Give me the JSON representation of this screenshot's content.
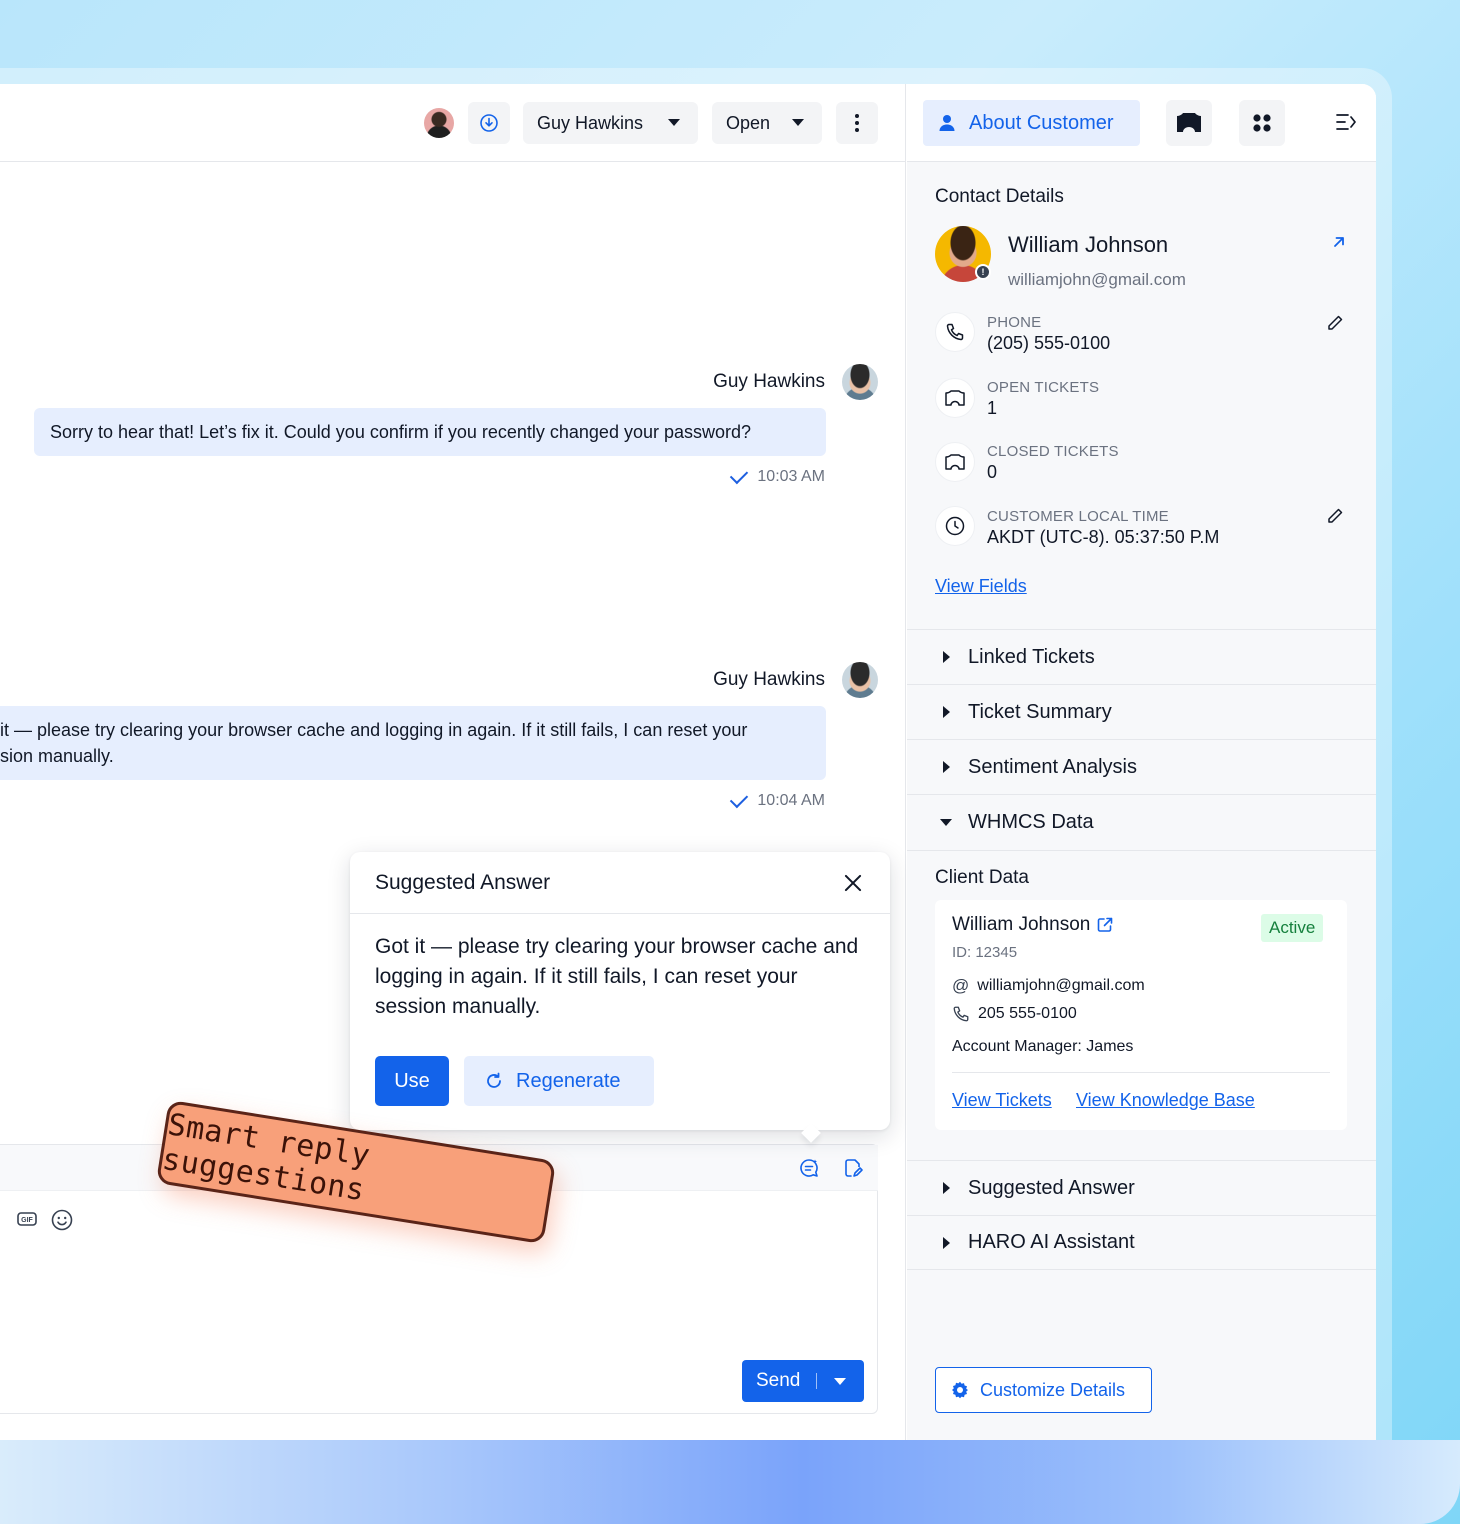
{
  "topbar": {
    "assignee": "Guy Hawkins",
    "status": "Open"
  },
  "messages": [
    {
      "author": "Guy Hawkins",
      "text": "Sorry to hear that! Let’s fix it. Could you confirm if you recently changed your password?",
      "time": "10:03 AM"
    },
    {
      "author": "Guy Hawkins",
      "line1": "it — please try clearing your browser cache and logging in again. If it still fails, I can reset your",
      "line2": "sion manually.",
      "time": "10:04 AM"
    }
  ],
  "suggested_popup": {
    "title": "Suggested Answer",
    "body": "Got it — please try clearing your browser cache and logging in again. If it still fails, I can reset your session manually.",
    "use_label": "Use",
    "regenerate_label": "Regenerate"
  },
  "sticker": "Smart reply suggestions",
  "composer": {
    "send_label": "Send"
  },
  "right_panel": {
    "tab_label": "About Customer",
    "contact_details_title": "Contact Details",
    "contact": {
      "name": "William Johnson",
      "email": "williamjohn@gmail.com"
    },
    "fields": [
      {
        "label": "PHONE",
        "value": "(205) 555-0100"
      },
      {
        "label": "OPEN TICKETS",
        "value": "1"
      },
      {
        "label": "CLOSED TICKETS",
        "value": "0"
      },
      {
        "label": "CUSTOMER LOCAL TIME",
        "value": "AKDT (UTC-8). 05:37:50 P.M"
      }
    ],
    "view_fields": "View Fields",
    "sections": [
      "Linked Tickets",
      "Ticket Summary",
      "Sentiment Analysis",
      "WHMCS Data"
    ],
    "client_data_title": "Client Data",
    "client_card": {
      "name": "William Johnson",
      "id": "ID: 12345",
      "status": "Active",
      "email": "williamjohn@gmail.com",
      "phone": "205 555-0100",
      "account_manager": "Account Manager: James",
      "view_tickets": "View Tickets",
      "view_kb": "View Knowledge Base"
    },
    "lower_sections": [
      "Suggested Answer",
      "HARO AI Assistant"
    ],
    "customize_label": "Customize Details"
  },
  "colors": {
    "accent": "#1363ea",
    "bubble": "#e6eefe",
    "sticker": "#f8a07a",
    "active_badge": "#dcfce7"
  }
}
